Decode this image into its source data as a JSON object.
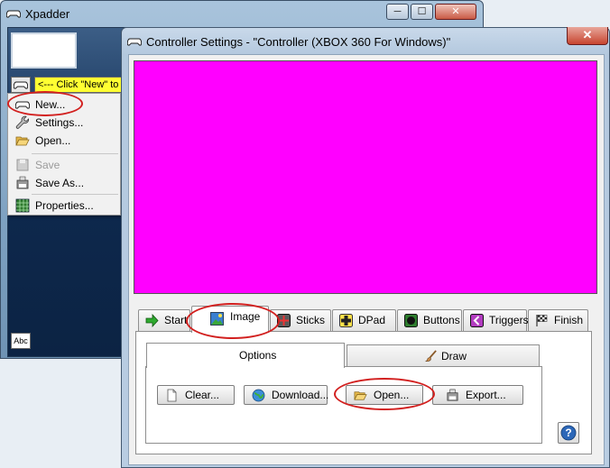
{
  "back_window": {
    "title": "Xpadder",
    "min_glyph": "─",
    "max_glyph": "☐",
    "close_glyph": "✕",
    "banner": "<--- Click \"New\" to c",
    "abc_glyph": "Abc",
    "menu": {
      "new_label": "New...",
      "settings_label": "Settings...",
      "open_label": "Open...",
      "save_label": "Save",
      "save_as_label": "Save As...",
      "properties_label": "Properties..."
    }
  },
  "dialog": {
    "title": "Controller Settings - \"Controller (XBOX 360 For Windows)\"",
    "close_glyph": "✕",
    "canvas_color": "#ff00ff",
    "tabs": {
      "start": "Start",
      "image": "Image",
      "sticks": "Sticks",
      "dpad": "DPad",
      "buttons": "Buttons",
      "triggers": "Triggers",
      "finish": "Finish"
    },
    "subtabs": {
      "options": "Options",
      "draw": "Draw"
    },
    "options_checked": true,
    "buttons": {
      "clear": "Clear...",
      "download": "Download...",
      "open": "Open...",
      "export": "Export..."
    },
    "help_glyph": "?"
  },
  "annotation_color": "#d2201f"
}
